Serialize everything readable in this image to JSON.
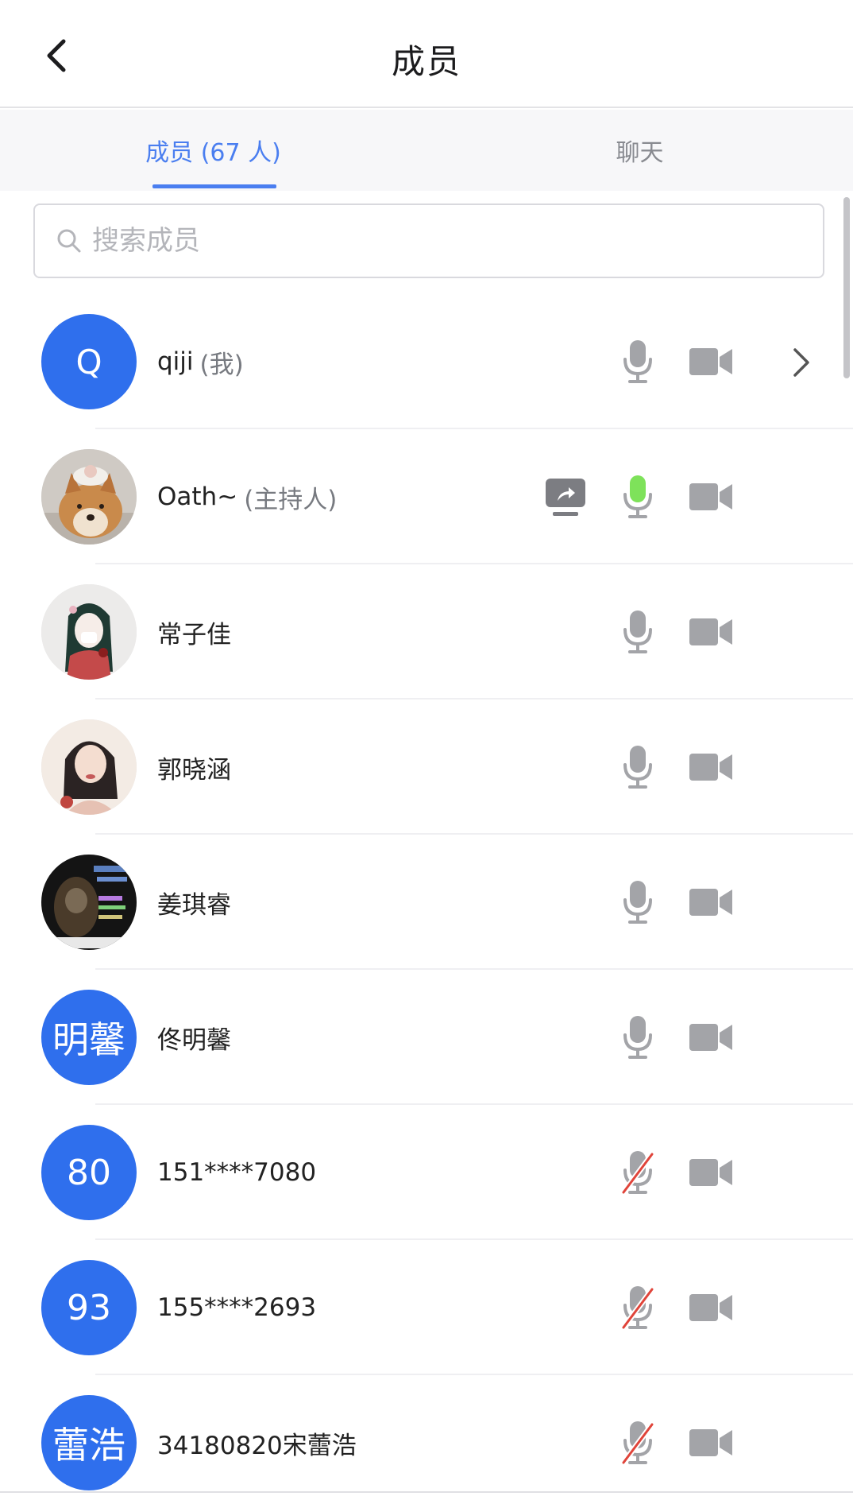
{
  "header": {
    "title": "成员",
    "back_icon": "chevron-left-icon"
  },
  "tabs": [
    {
      "label": "成员 (67 人)",
      "active": true
    },
    {
      "label": "聊天",
      "active": false
    }
  ],
  "search": {
    "placeholder": "搜索成员",
    "value": "",
    "icon": "search-icon"
  },
  "colors": {
    "accent": "#4a7ef0",
    "avatar_blue": "#2f6fed",
    "mic_active": "#7ee25a",
    "muted_slash": "#e0443a",
    "icon_gray": "#a3a4a8"
  },
  "members": [
    {
      "name": "qiji",
      "role": "(我)",
      "avatar_text": "Q",
      "avatar_type": "letter",
      "mic": "on",
      "share": false,
      "chevron": true
    },
    {
      "name": "Oath~",
      "role": "(主持人)",
      "avatar_text": "",
      "avatar_type": "photo-dog",
      "mic": "speaking",
      "share": true,
      "chevron": false
    },
    {
      "name": "常子佳",
      "role": "",
      "avatar_text": "",
      "avatar_type": "photo-girl-anime",
      "mic": "on",
      "share": false,
      "chevron": false
    },
    {
      "name": "郭晓涵",
      "role": "",
      "avatar_text": "",
      "avatar_type": "photo-girl-portrait",
      "mic": "on",
      "share": false,
      "chevron": false
    },
    {
      "name": "姜琪睿",
      "role": "",
      "avatar_text": "",
      "avatar_type": "photo-dark",
      "mic": "on",
      "share": false,
      "chevron": false
    },
    {
      "name": "佟明馨",
      "role": "",
      "avatar_text": "明馨",
      "avatar_type": "cjk",
      "mic": "on",
      "share": false,
      "chevron": false
    },
    {
      "name": "151****7080",
      "role": "",
      "avatar_text": "80",
      "avatar_type": "num",
      "mic": "muted",
      "share": false,
      "chevron": false
    },
    {
      "name": "155****2693",
      "role": "",
      "avatar_text": "93",
      "avatar_type": "num",
      "mic": "muted",
      "share": false,
      "chevron": false
    },
    {
      "name": "34180820宋蕾浩",
      "role": "",
      "avatar_text": "蕾浩",
      "avatar_type": "cjk",
      "mic": "muted",
      "share": false,
      "chevron": false
    }
  ]
}
